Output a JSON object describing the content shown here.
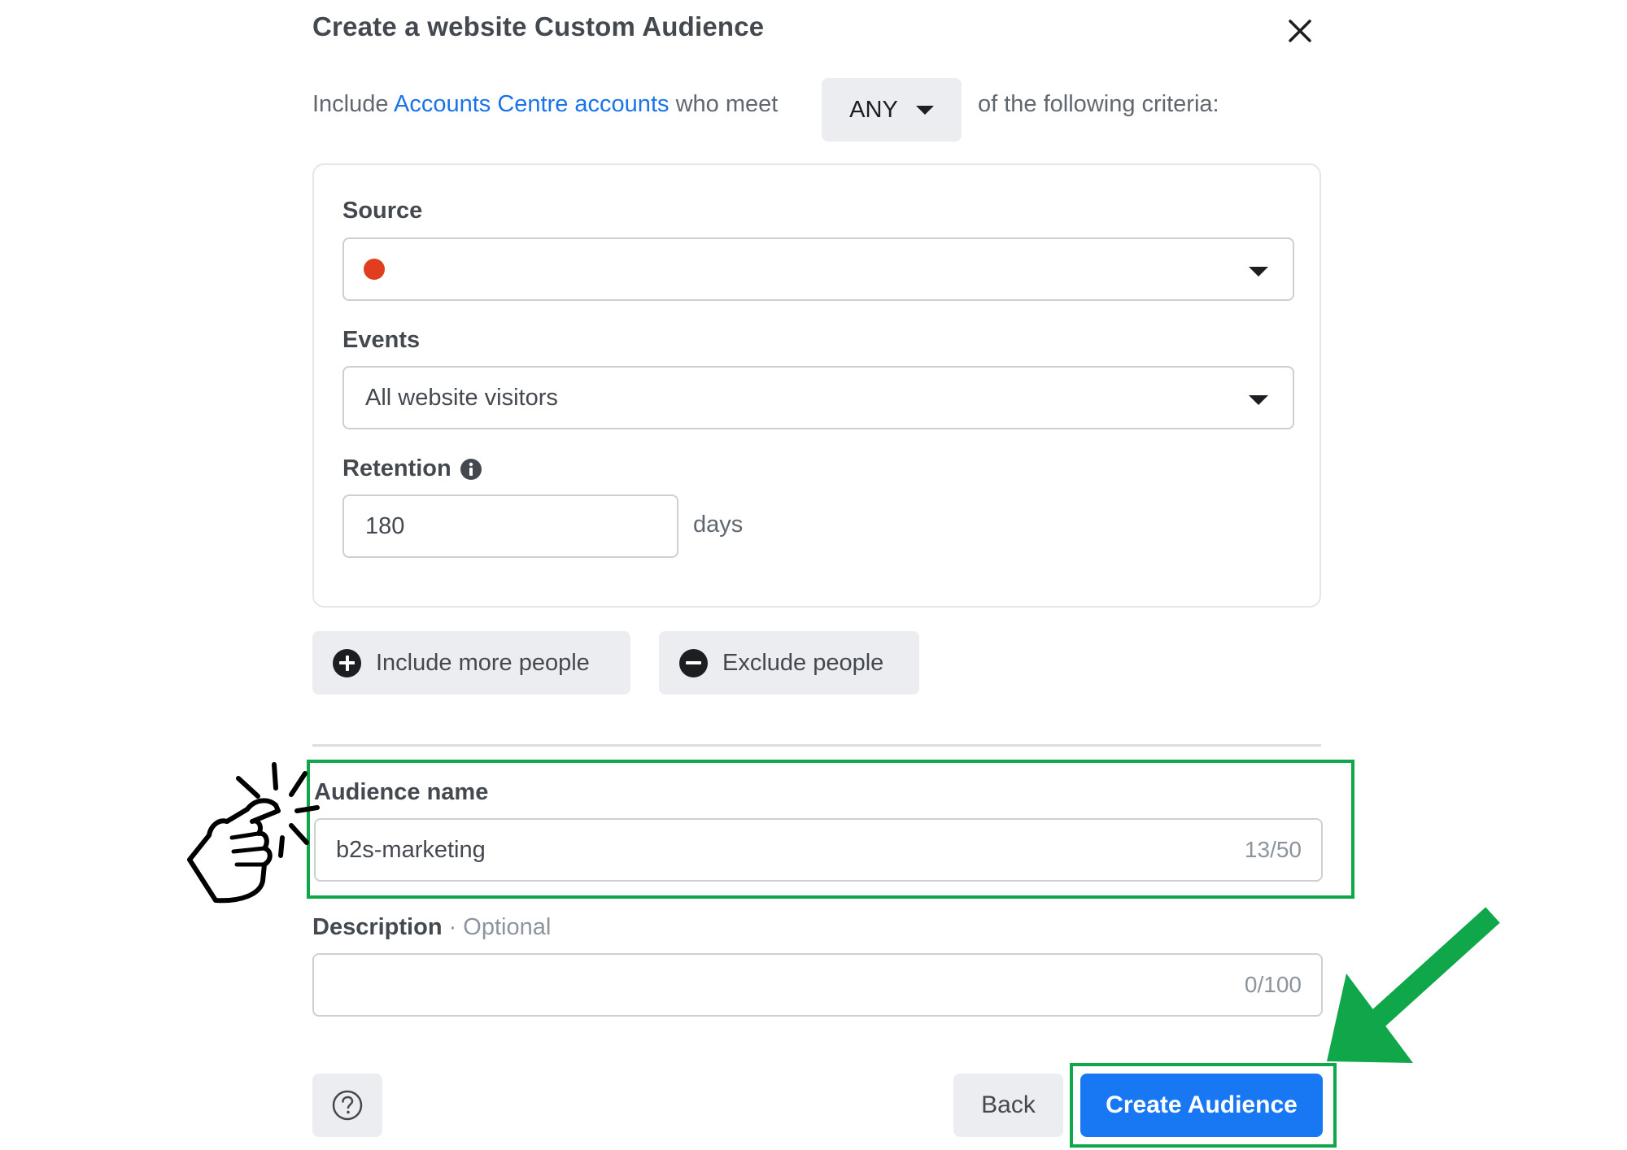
{
  "dialog": {
    "title": "Create a website Custom Audience",
    "close_icon": "close-icon"
  },
  "criteria": {
    "prefix": "Include",
    "link_text": "Accounts Centre accounts",
    "middle": "who meet",
    "match_value": "ANY",
    "suffix": "of the following criteria:"
  },
  "rule": {
    "source_label": "Source",
    "source_status_color": "#e03e1f",
    "events_label": "Events",
    "events_value": "All website visitors",
    "retention_label": "Retention",
    "retention_value": "180",
    "retention_unit": "days"
  },
  "actions": {
    "include_label": "Include more people",
    "exclude_label": "Exclude people"
  },
  "audience": {
    "name_label": "Audience name",
    "name_value": "b2s-marketing",
    "name_counter": "13/50",
    "description_label": "Description",
    "description_optional": "· Optional",
    "description_value": "",
    "description_counter": "0/100"
  },
  "footer": {
    "help_icon": "question-circle-icon",
    "back_label": "Back",
    "create_label": "Create Audience"
  },
  "colors": {
    "accent": "#1877f2",
    "highlight": "#10a64a",
    "link": "#1a73e8"
  }
}
